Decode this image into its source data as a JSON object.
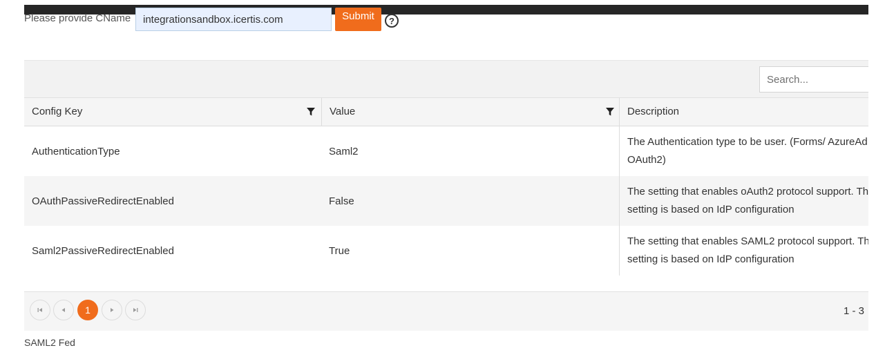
{
  "cname_form": {
    "label": "Please provide CName",
    "input_value": "integrationsandbox.icertis.com",
    "submit_label": "Submit",
    "help_glyph": "?",
    "help_icon": "question-circle-icon"
  },
  "grid": {
    "search_placeholder": "Search...",
    "columns": [
      {
        "label": "Config Key",
        "filter_icon": "filter-icon"
      },
      {
        "label": "Value",
        "filter_icon": "filter-icon"
      },
      {
        "label": "Description"
      }
    ],
    "rows": [
      {
        "key": "AuthenticationType",
        "value": "Saml2",
        "description": [
          "The Authentication type to be user. (Forms/ AzureAd",
          "OAuth2)"
        ]
      },
      {
        "key": "OAuthPassiveRedirectEnabled",
        "value": "False",
        "description": [
          "The setting that enables oAuth2 protocol support. Th",
          "setting is based on IdP configuration"
        ]
      },
      {
        "key": "Saml2PassiveRedirectEnabled",
        "value": "True",
        "description": [
          "The setting that enables SAML2 protocol support. Th",
          "setting is based on IdP configuration"
        ]
      }
    ],
    "pager": {
      "first_icon": "first-page-icon",
      "prev_icon": "previous-page-icon",
      "current_page": "1",
      "next_icon": "next-page-icon",
      "last_icon": "last-page-icon",
      "info": "1 - 3"
    }
  },
  "footer_text": "SAML2 Fed",
  "colors": {
    "accent": "#f06c1c",
    "topbar": "#262626",
    "input_bg": "#e8f0fe"
  }
}
